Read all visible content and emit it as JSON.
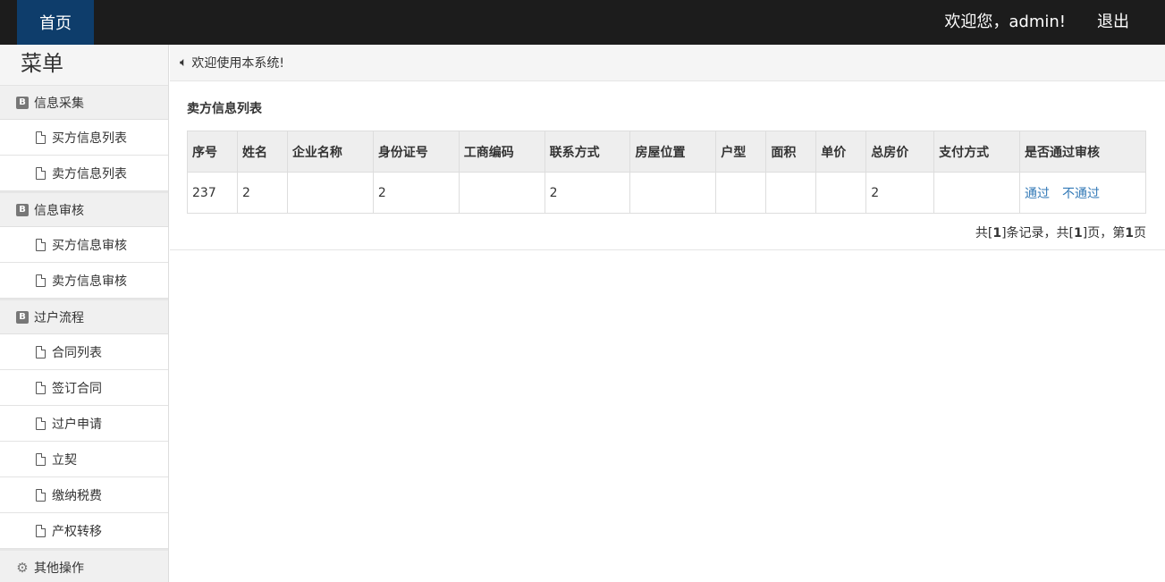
{
  "topbar": {
    "home_label": "首页",
    "welcome_text": "欢迎您，admin!",
    "logout_label": "退出",
    "accent_color": "#0e3d6b"
  },
  "sidebar": {
    "title": "菜单",
    "groups": [
      {
        "label": "信息采集",
        "icon": "bootstrap-badge-icon",
        "items": [
          "买方信息列表",
          "卖方信息列表"
        ]
      },
      {
        "label": "信息审核",
        "icon": "bootstrap-badge-icon",
        "items": [
          "买方信息审核",
          "卖方信息审核"
        ]
      },
      {
        "label": "过户流程",
        "icon": "bootstrap-badge-icon",
        "items": [
          "合同列表",
          "签订合同",
          "过户申请",
          "立契",
          "缴纳税费",
          "产权转移"
        ]
      },
      {
        "label": "其他操作",
        "icon": "gear-icon",
        "items": []
      }
    ]
  },
  "notice": {
    "text": "欢迎使用本系统!"
  },
  "main": {
    "section_title": "卖方信息列表",
    "table": {
      "columns": [
        "序号",
        "姓名",
        "企业名称",
        "身份证号",
        "工商编码",
        "联系方式",
        "房屋位置",
        "户型",
        "面积",
        "单价",
        "总房价",
        "支付方式",
        "是否通过审核"
      ],
      "rows": [
        {
          "cells": [
            "237",
            "2",
            "",
            "2",
            "",
            "2",
            "",
            "",
            "",
            "",
            "2",
            ""
          ],
          "approve_label": "通过",
          "reject_label": "不通过"
        }
      ]
    },
    "pager": {
      "prefix": "共[",
      "total_records": "1",
      "mid1": "]条记录，共[",
      "total_pages": "1",
      "mid2": "]页，第",
      "current_page": "1",
      "suffix": "页"
    }
  }
}
